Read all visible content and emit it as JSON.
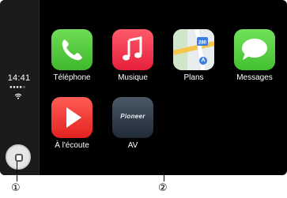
{
  "status": {
    "time": "14:41",
    "signal": "●●●●○"
  },
  "apps": [
    {
      "id": "telephone",
      "label": "Téléphone",
      "icon": "phone-icon"
    },
    {
      "id": "musique",
      "label": "Musique",
      "icon": "music-note-icon"
    },
    {
      "id": "plans",
      "label": "Plans",
      "icon": "map-icon",
      "badge": "280"
    },
    {
      "id": "messages",
      "label": "Messages",
      "icon": "speech-bubble-icon"
    },
    {
      "id": "a-lecoute",
      "label": "À l'écoute",
      "icon": "play-icon"
    },
    {
      "id": "av",
      "label": "AV",
      "icon": "pioneer-logo-icon",
      "logo_text": "Pioneer"
    }
  ],
  "callouts": {
    "home": "①",
    "av": "②"
  },
  "colors": {
    "background": "#000000",
    "sidebar": "#1b1b1b"
  }
}
